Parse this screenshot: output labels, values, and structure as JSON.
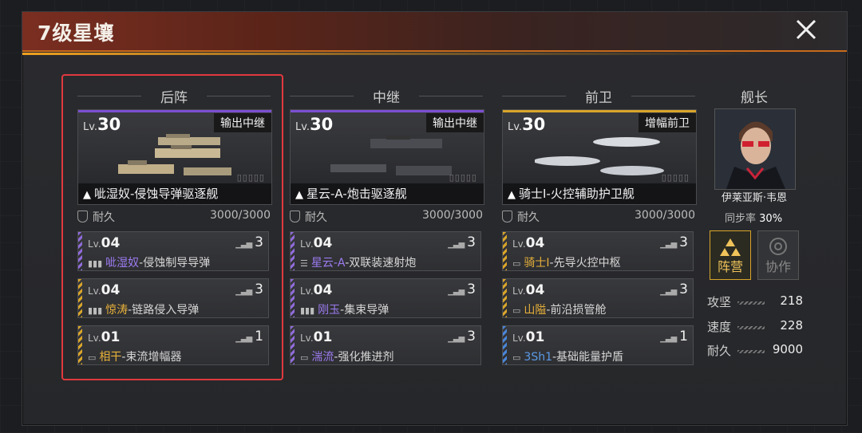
{
  "window": {
    "title": "7级星壤"
  },
  "columns": [
    {
      "header": "后阵",
      "ship": {
        "lv_prefix": "Lv.",
        "level": "30",
        "role": "输出中继",
        "name": "呲湿奴-侵蚀导弹驱逐舰",
        "stripe_color": "#7b4fd0"
      },
      "durability": {
        "label": "耐久",
        "value": "3000/3000"
      },
      "equips": [
        {
          "lv_prefix": "Lv.",
          "level": "04",
          "count": "3",
          "color": "#8f6bd9",
          "highlight": "呲湿奴",
          "rest": "-侵蚀制导导弹"
        },
        {
          "lv_prefix": "Lv.",
          "level": "04",
          "count": "3",
          "color": "#d9a52a",
          "highlight": "惊涛",
          "rest": "-链路侵入导弹"
        },
        {
          "lv_prefix": "Lv.",
          "level": "01",
          "count": "1",
          "color": "#d9a52a",
          "highlight": "相干",
          "rest": "-束流增幅器"
        }
      ]
    },
    {
      "header": "中继",
      "ship": {
        "lv_prefix": "Lv.",
        "level": "30",
        "role": "输出中继",
        "name": "星云-A-炮击驱逐舰",
        "stripe_color": "#7b4fd0"
      },
      "durability": {
        "label": "耐久",
        "value": "3000/3000"
      },
      "equips": [
        {
          "lv_prefix": "Lv.",
          "level": "04",
          "count": "3",
          "color": "#8f6bd9",
          "highlight": "星云-A",
          "rest": "-双联装速射炮"
        },
        {
          "lv_prefix": "Lv.",
          "level": "04",
          "count": "3",
          "color": "#8f6bd9",
          "highlight": "刚玉",
          "rest": "-集束导弹"
        },
        {
          "lv_prefix": "Lv.",
          "level": "01",
          "count": "3",
          "color": "#8f6bd9",
          "highlight": "湍流",
          "rest": "-强化推进剂"
        }
      ]
    },
    {
      "header": "前卫",
      "ship": {
        "lv_prefix": "Lv.",
        "level": "30",
        "role": "增幅前卫",
        "name": "骑士I-火控辅助护卫舰",
        "stripe_color": "#d9a52a"
      },
      "durability": {
        "label": "耐久",
        "value": "3000/3000"
      },
      "equips": [
        {
          "lv_prefix": "Lv.",
          "level": "04",
          "count": "3",
          "color": "#d9a52a",
          "highlight": "骑士I",
          "rest": "-先导火控中枢"
        },
        {
          "lv_prefix": "Lv.",
          "level": "04",
          "count": "3",
          "color": "#d9a52a",
          "highlight": "山隘",
          "rest": "-前沿损管舱"
        },
        {
          "lv_prefix": "Lv.",
          "level": "01",
          "count": "1",
          "color": "#4a86d9",
          "highlight": "3Sh1",
          "rest": "-基础能量护盾"
        }
      ]
    }
  ],
  "captain": {
    "header": "舰长",
    "name": "伊莱亚斯·韦恩",
    "sync_label": "同步率",
    "sync_value": "30%",
    "camp_label": "阵营",
    "coop_label": "协作",
    "stats": [
      {
        "label": "攻坚",
        "value": "218"
      },
      {
        "label": "速度",
        "value": "228"
      },
      {
        "label": "耐久",
        "value": "9000"
      }
    ]
  },
  "colors": {
    "selection": "#e0393e",
    "accent": "#f0a020",
    "purple": "#7b4fd0",
    "gold": "#d9a52a",
    "blue": "#4a86d9"
  }
}
